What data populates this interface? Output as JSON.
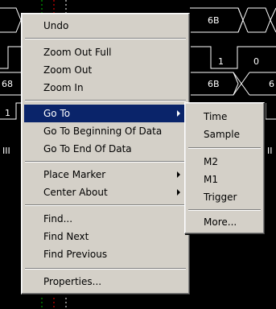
{
  "waveform": {
    "labels": {
      "bus_a_value_1": "6B",
      "bus_b_value_1": "1",
      "bus_b_value_2": "0",
      "bus_c_left_value": "68",
      "bus_c_value_1": "6B",
      "bus_c_right_value": "6",
      "bus_d_left_value": "1",
      "left_marker": "III",
      "right_marker": "II"
    }
  },
  "context_menu": {
    "items": [
      {
        "label": "Undo"
      },
      {
        "label": "Zoom Out Full"
      },
      {
        "label": "Zoom Out"
      },
      {
        "label": "Zoom In"
      },
      {
        "label": "Go To",
        "submenu": true,
        "selected": true
      },
      {
        "label": "Go To Beginning Of Data"
      },
      {
        "label": "Go To End Of Data"
      },
      {
        "label": "Place Marker",
        "submenu": true
      },
      {
        "label": "Center About",
        "submenu": true
      },
      {
        "label": "Find..."
      },
      {
        "label": "Find Next"
      },
      {
        "label": "Find Previous"
      },
      {
        "label": "Properties..."
      }
    ]
  },
  "goto_submenu": {
    "items": [
      {
        "label": "Time"
      },
      {
        "label": "Sample"
      },
      {
        "label": "M2"
      },
      {
        "label": "M1"
      },
      {
        "label": "Trigger"
      },
      {
        "label": "More..."
      }
    ]
  },
  "colors": {
    "menu_bg": "#d4d0c8",
    "highlight": "#0a246a",
    "highlight_text": "#ffffff",
    "wave_bg": "#000000",
    "wave_line": "#ffffff",
    "cursor_green": "#00c000",
    "cursor_red": "#ff0000"
  }
}
